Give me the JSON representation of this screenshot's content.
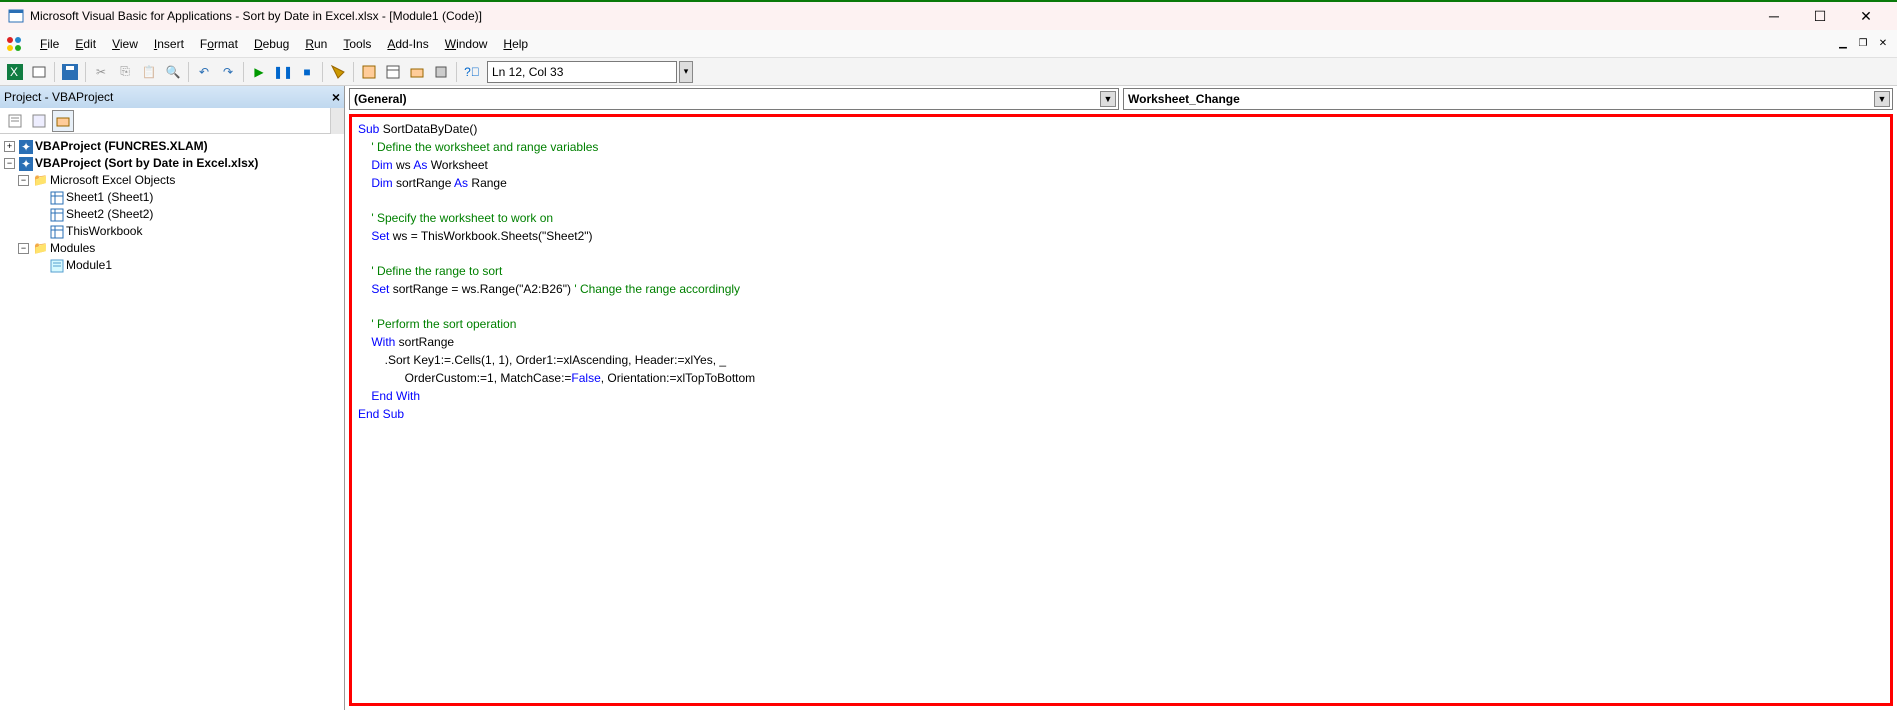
{
  "titlebar": {
    "title": "Microsoft Visual Basic for Applications - Sort by Date in Excel.xlsx - [Module1 (Code)]"
  },
  "menubar": {
    "items": [
      "File",
      "Edit",
      "View",
      "Insert",
      "Format",
      "Debug",
      "Run",
      "Tools",
      "Add-Ins",
      "Window",
      "Help"
    ]
  },
  "toolbar": {
    "position": "Ln 12, Col 33"
  },
  "project_panel": {
    "title": "Project - VBAProject",
    "tree": {
      "root1": "VBAProject (FUNCRES.XLAM)",
      "root2": "VBAProject (Sort by Date in Excel.xlsx)",
      "folder1": "Microsoft Excel Objects",
      "sheet1": "Sheet1 (Sheet1)",
      "sheet2": "Sheet2 (Sheet2)",
      "thiswb": "ThisWorkbook",
      "folder2": "Modules",
      "module1": "Module1"
    }
  },
  "code_combos": {
    "left": "(General)",
    "right": "Worksheet_Change"
  },
  "code": {
    "l1a": "Sub",
    "l1b": " SortDataByDate()",
    "l2": "    ' Define the worksheet and range variables",
    "l3a": "    Dim",
    "l3b": " ws ",
    "l3c": "As",
    "l3d": " Worksheet",
    "l4a": "    Dim",
    "l4b": " sortRange ",
    "l4c": "As",
    "l4d": " Range",
    "l6": "    ' Specify the worksheet to work on",
    "l7a": "    Set",
    "l7b": " ws = ThisWorkbook.Sheets(\"Sheet2\")",
    "l9": "    ' Define the range to sort",
    "l10a": "    Set",
    "l10b": " sortRange = ws.Range(\"A2:B26\") ",
    "l10c": "' Change the range accordingly",
    "l12": "    ' Perform the sort operation",
    "l13a": "    With",
    "l13b": " sortRange",
    "l14": "        .Sort Key1:=.Cells(1, 1), Order1:=xlAscending, Header:=xlYes, _",
    "l15a": "              OrderCustom:=1, MatchCase:=",
    "l15b": "False",
    "l15c": ", Orientation:=xlTopToBottom",
    "l16": "    End With",
    "l17": "End Sub"
  }
}
